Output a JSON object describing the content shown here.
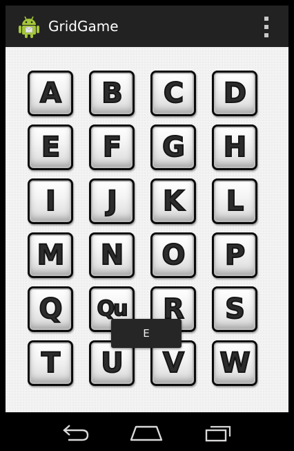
{
  "app": {
    "title": "GridGame"
  },
  "action_bar": {
    "menu_icon": "overflow-menu-icon",
    "app_icon": "android-robot-icon"
  },
  "grid": {
    "tiles": [
      "A",
      "B",
      "C",
      "D",
      "E",
      "F",
      "G",
      "H",
      "I",
      "J",
      "K",
      "L",
      "M",
      "N",
      "O",
      "P",
      "Q",
      "Qu",
      "R",
      "S",
      "T",
      "U",
      "V",
      "W"
    ]
  },
  "toast": {
    "text": "E"
  },
  "nav": {
    "back_icon": "back-icon",
    "home_icon": "home-icon",
    "recents_icon": "recents-icon"
  },
  "colors": {
    "action_bar": "#222222",
    "background": "#f3f3f3",
    "tile_border": "#0a0a0a",
    "toast": "#262626"
  }
}
